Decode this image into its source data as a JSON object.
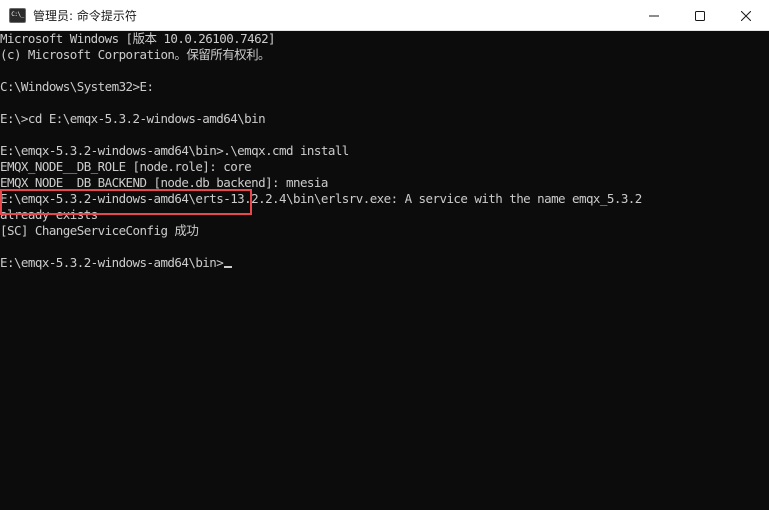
{
  "window": {
    "title": "管理员: 命令提示符",
    "icon_label": "C:\\_"
  },
  "console": {
    "lines": [
      "Microsoft Windows [版本 10.0.26100.7462]",
      "(c) Microsoft Corporation。保留所有权利。",
      "",
      "C:\\Windows\\System32>E:",
      "",
      "E:\\>cd E:\\emqx-5.3.2-windows-amd64\\bin",
      "",
      "E:\\emqx-5.3.2-windows-amd64\\bin>.\\emqx.cmd install",
      "EMQX_NODE__DB_ROLE [node.role]: core",
      "EMQX_NODE__DB_BACKEND [node.db_backend]: mnesia",
      "E:\\emqx-5.3.2-windows-amd64\\erts-13.2.2.4\\bin\\erlsrv.exe: A service with the name emqx_5.3.2",
      "already exists",
      "[SC] ChangeServiceConfig 成功",
      "",
      "E:\\emqx-5.3.2-windows-amd64\\bin>"
    ]
  },
  "colors": {
    "background": "#0c0c0c",
    "text": "#cccccc",
    "highlight": "#e8484c",
    "titlebar": "#ffffff"
  }
}
